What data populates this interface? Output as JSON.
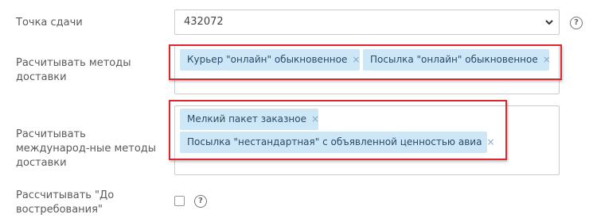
{
  "fields": {
    "point": {
      "label": "Точка сдачи",
      "value": "432072"
    },
    "methods": {
      "label": "Расчитывать методы доставки",
      "tags": [
        {
          "label": "Курьер \"онлайн\" обыкновенное",
          "remove": "×"
        },
        {
          "label": "Посылка \"онлайн\" обыкновенное",
          "remove": "×"
        }
      ]
    },
    "intl_methods": {
      "label": "Расчитывать международ-ные методы доставки",
      "tags": [
        {
          "label": "Мелкий пакет заказное",
          "remove": "×"
        },
        {
          "label": "Посылка \"нестандартная\" с объявленной ценностью авиа",
          "remove": "×"
        }
      ]
    },
    "poste_restante": {
      "label": "Рассчитывать \"До востребования\"",
      "checked": false
    }
  },
  "help_icon_glyph": "?",
  "icons": {
    "help": "help-circle-icon",
    "dropdown": "chevron-down-icon",
    "remove": "close-icon"
  },
  "colors": {
    "highlight": "#e0262d",
    "tag_bg": "#cde7f6",
    "tag_text": "#2a4a68"
  }
}
